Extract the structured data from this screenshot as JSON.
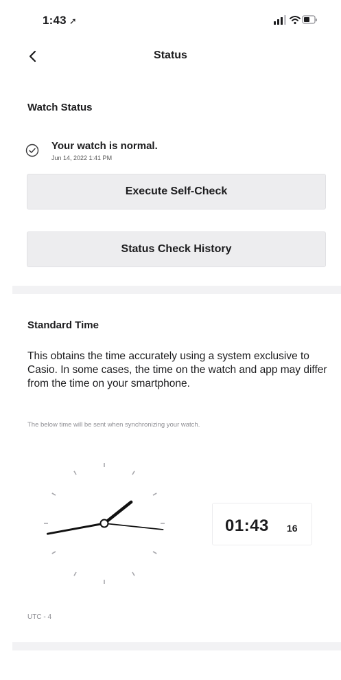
{
  "status_bar": {
    "time": "1:43",
    "location_arrow": "location-arrow-icon",
    "icons": [
      "signal-icon",
      "wifi-icon",
      "battery-icon"
    ]
  },
  "nav": {
    "back_icon": "chevron-left-icon",
    "title": "Status"
  },
  "watch_status": {
    "heading": "Watch Status",
    "status_icon": "check-circle-icon",
    "message": "Your watch is normal.",
    "timestamp": "Jun 14, 2022 1:41 PM",
    "self_check_label": "Execute Self-Check",
    "history_label": "Status Check History"
  },
  "standard_time": {
    "heading": "Standard Time",
    "description": "This obtains the time accurately using a system exclusive to Casio. In some cases, the time on the watch and app may differ from the time on your smartphone.",
    "note": "The below time will be sent when synchronizing your watch.",
    "time_hm": "01:43",
    "time_sec": "16",
    "hour": 1,
    "minute": 43,
    "second": 16,
    "timezone": "UTC - 4"
  }
}
